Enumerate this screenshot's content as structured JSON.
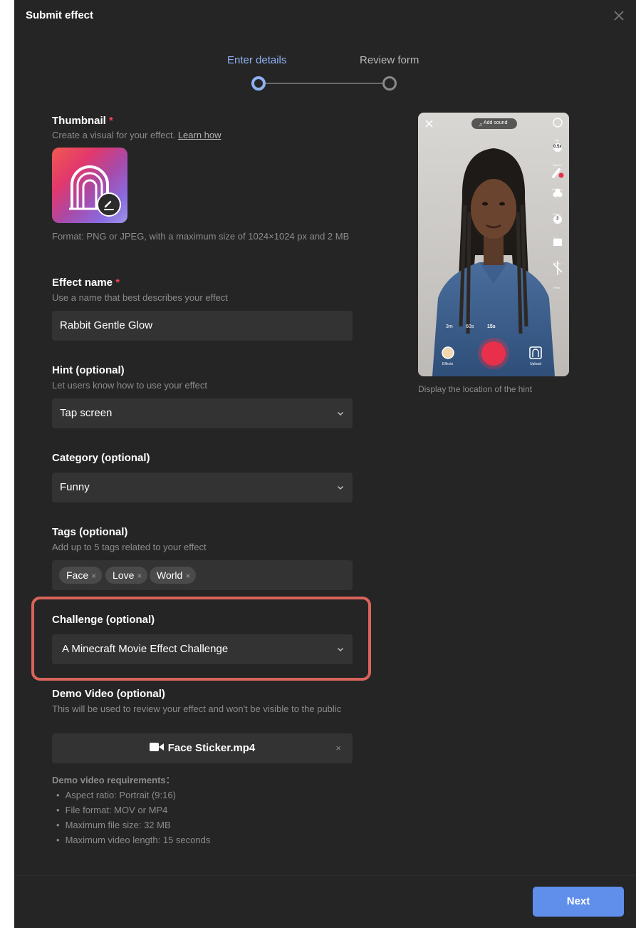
{
  "dialog": {
    "title": "Submit effect"
  },
  "stepper": {
    "steps": [
      {
        "label": "Enter details",
        "active": true
      },
      {
        "label": "Review form",
        "active": false
      }
    ]
  },
  "thumbnail": {
    "label": "Thumbnail",
    "required_mark": "*",
    "help": "Create a visual for your effect.",
    "learn_link": "Learn how",
    "format_note": "Format: PNG or JPEG, with a maximum size of 1024×1024 px and 2 MB"
  },
  "effect_name": {
    "label": "Effect name",
    "required_mark": "*",
    "help": "Use a name that best describes your effect",
    "value": "Rabbit Gentle Glow"
  },
  "hint": {
    "label": "Hint (optional)",
    "help": "Let users know how to use your effect",
    "value": "Tap screen"
  },
  "category": {
    "label": "Category (optional)",
    "value": "Funny"
  },
  "tags": {
    "label": "Tags (optional)",
    "help": "Add up to 5 tags related to your effect",
    "items": [
      "Face",
      "Love",
      "World"
    ],
    "remove_glyph": "×"
  },
  "challenge": {
    "label": "Challenge (optional)",
    "value": "A Minecraft Movie Effect Challenge"
  },
  "demo_video": {
    "label": "Demo Video (optional)",
    "help": "This will be used to review your effect and won't be visible to the public",
    "file_name": "Face Sticker.mp4",
    "remove_glyph": "×",
    "requirements_title": "Demo video requirements：",
    "requirements": [
      "Aspect ratio: Portrait (9:16)",
      "File format: MOV or MP4",
      "Maximum file size: 32 MB",
      "Maximum video length: 15 seconds"
    ]
  },
  "preview": {
    "add_sound": "Add sound",
    "durations": [
      "3m",
      "60s",
      "15s"
    ],
    "side_tools": [
      "Flip",
      "Speed",
      "Retouch",
      "Filters",
      "Timer",
      "Photo",
      "Flash"
    ],
    "speed_value": "0.5x",
    "timer_value": "3",
    "effects_label": "Effects",
    "upload_label": "Upload",
    "caption": "Display the location of the hint"
  },
  "footer": {
    "next_label": "Next"
  },
  "colors": {
    "accent": "#5f8eeb",
    "step_active": "#8fb1f3",
    "highlight": "#d9645a",
    "required": "#f0474f",
    "record": "#e8304a"
  }
}
